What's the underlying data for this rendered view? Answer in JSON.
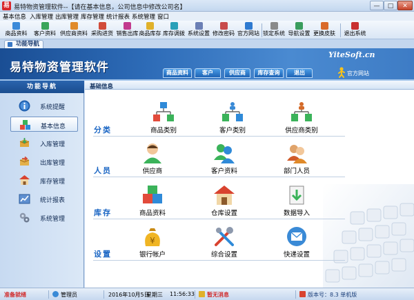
{
  "window": {
    "title": "易特物资管理软件--【请在基本信息，公司信息中修改公司名】",
    "app_icon_glyph": "易",
    "controls": {
      "minimize": "—",
      "maximize": "□",
      "close": "✕"
    }
  },
  "menu": [
    "基本信息",
    "入库管理",
    "出库管理",
    "库存管理",
    "统计报表",
    "系统管理",
    "窗口"
  ],
  "toolbar": [
    {
      "label": "商品资料",
      "icon": "goods-icon",
      "color": "#3b8ad9"
    },
    {
      "label": "客户资料",
      "icon": "customer-icon",
      "color": "#3aa55a"
    },
    {
      "label": "供应商资料",
      "icon": "supplier-icon",
      "color": "#e08a2a"
    },
    {
      "label": "采购进货",
      "icon": "purchase-icon",
      "color": "#d14b3a"
    },
    {
      "label": "销售出库",
      "icon": "sales-icon",
      "color": "#c23a8e"
    },
    {
      "label": "商品库存",
      "icon": "stock-icon",
      "color": "#e0b12a"
    },
    {
      "label": "库存调拨",
      "icon": "transfer-icon",
      "color": "#2aa0b8"
    },
    {
      "label": "系统设置",
      "icon": "settings-icon",
      "color": "#6b7fb5"
    },
    {
      "label": "修改密码",
      "icon": "password-icon",
      "color": "#c84b4b"
    },
    {
      "label": "官方网站",
      "icon": "website-icon",
      "color": "#2f7ad0"
    },
    {
      "label": "锁定系统",
      "icon": "lock-icon",
      "color": "#8a8a8a"
    },
    {
      "label": "导航设置",
      "icon": "navigation-icon",
      "color": "#3a9d5d"
    },
    {
      "label": "更换皮肤",
      "icon": "skin-icon",
      "color": "#d96a2a"
    },
    {
      "label": "退出系统",
      "icon": "exit-icon",
      "color": "#c93030"
    }
  ],
  "tab": {
    "label": "功能导航"
  },
  "banner": {
    "brand": "易特物资管理软件",
    "brand_en": "YiteSoft.cn",
    "nav_tabs": [
      "商品资料",
      "客户",
      "供应商",
      "库存查询",
      "退出"
    ],
    "official": "官方网站"
  },
  "sidebar": {
    "title": "功能导航",
    "items": [
      {
        "label": "系统提醒",
        "icon": "info-icon"
      },
      {
        "label": "基本信息",
        "icon": "cube-icon"
      },
      {
        "label": "入库管理",
        "icon": "inbound-icon"
      },
      {
        "label": "出库管理",
        "icon": "outbound-icon"
      },
      {
        "label": "库存管理",
        "icon": "warehouse-icon"
      },
      {
        "label": "统计报表",
        "icon": "chart-icon"
      },
      {
        "label": "系统管理",
        "icon": "gears-icon"
      }
    ],
    "active": 1
  },
  "content": {
    "title": "基础信息",
    "sections": [
      {
        "label": "分类",
        "tiles": [
          "商品类别",
          "客户类别",
          "供应商类别"
        ]
      },
      {
        "label": "人员",
        "tiles": [
          "供应商",
          "客户资料",
          "部门人员"
        ]
      },
      {
        "label": "库存",
        "tiles": [
          "商品资料",
          "仓库设置",
          "数据导入"
        ]
      },
      {
        "label": "设置",
        "tiles": [
          "银行帐户",
          "综合设置",
          "快递设置"
        ]
      }
    ]
  },
  "statusbar": {
    "status": "准备就绪",
    "user": "管理员",
    "date": "2016年10月5日",
    "weekday": "星期三",
    "time": "11:56:33",
    "messages": "暂无消息",
    "version": "版本号：8.3 单机版"
  }
}
